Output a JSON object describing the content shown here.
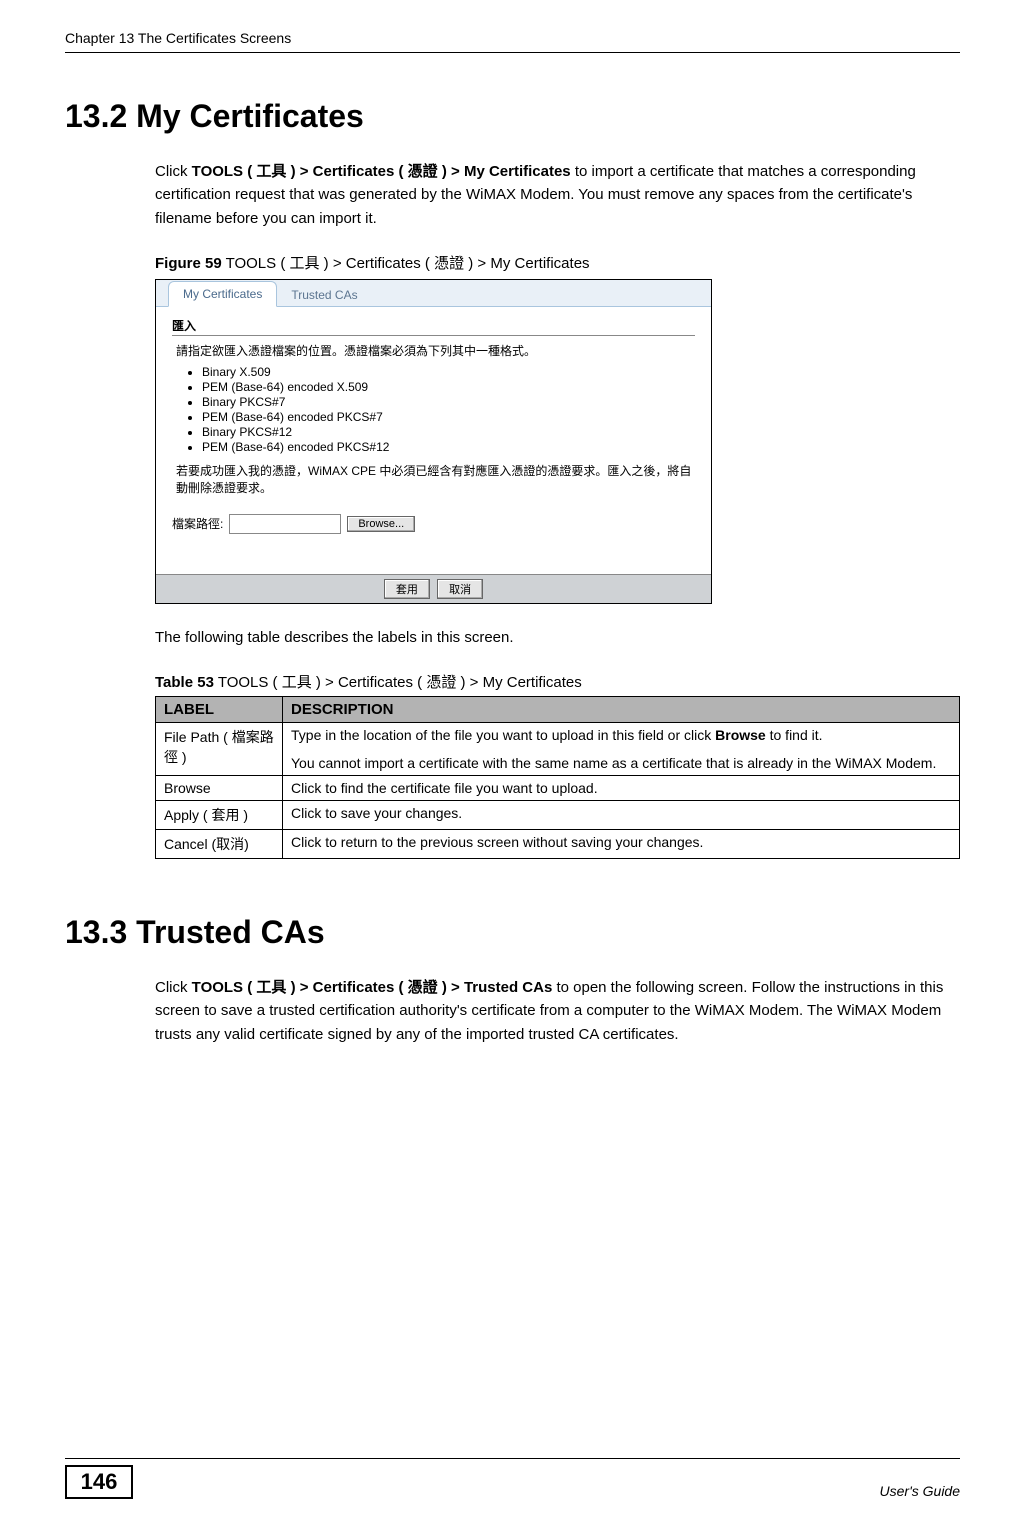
{
  "header": {
    "running": "Chapter 13 The Certificates Screens"
  },
  "s1": {
    "heading": "13.2  My Certificates",
    "para_parts": {
      "p1": "Click ",
      "b1": "TOOLS ( 工具 ) > Certificates ( 憑證 ) > My Certificates",
      "p2": "  to import a certificate that matches a corresponding certification request that was generated by the WiMAX Modem. You must remove any spaces from the certificate's filename before you can import it."
    },
    "fig_label": "Figure 59",
    "fig_caption": "   TOOLS ( 工具 ) > Certificates ( 憑證 ) > My Certificates"
  },
  "screenshot": {
    "tabs": {
      "active": "My Certificates",
      "inactive": "Trusted CAs"
    },
    "section_title": "匯入",
    "desc": "請指定欲匯入憑證檔案的位置。憑證檔案必須為下列其中一種格式。",
    "formats": [
      "Binary X.509",
      "PEM (Base-64) encoded X.509",
      "Binary PKCS#7",
      "PEM (Base-64) encoded PKCS#7",
      "Binary PKCS#12",
      "PEM (Base-64) encoded PKCS#12"
    ],
    "note": "若要成功匯入我的憑證，WiMAX CPE 中必須已經含有對應匯入憑證的憑證要求。匯入之後，將自動刪除憑證要求。",
    "path_label": "檔案路徑:",
    "browse_btn": "Browse...",
    "apply_btn": "套用",
    "cancel_btn": "取消"
  },
  "after_fig": "The following table describes the labels in this screen.",
  "table": {
    "caption_label": "Table 53",
    "caption_text": "   TOOLS ( 工具 ) > Certificates ( 憑證 ) > My Certificates",
    "head": {
      "label": "LABEL",
      "desc": "DESCRIPTION"
    },
    "rows": [
      {
        "label": "File Path ( 檔案路徑 )",
        "desc_p1_a": "Type in the location of the file you want to upload in this field or click ",
        "desc_p1_b": "Browse",
        "desc_p1_c": " to find it.",
        "desc_p2": "You cannot import a certificate with the same name as a certificate that is already in the WiMAX Modem."
      },
      {
        "label": "Browse",
        "desc": "Click to find the certificate file you want to upload."
      },
      {
        "label": "Apply ( 套用 )",
        "desc": "Click to save your changes."
      },
      {
        "label": "Cancel (取消)",
        "desc": "Click to return to the previous screen without saving your changes."
      }
    ]
  },
  "s2": {
    "heading": "13.3  Trusted CAs",
    "para_parts": {
      "p1": "Click ",
      "b1": "TOOLS ( 工具 ) > Certificates ( 憑證 ) > Trusted CAs",
      "p2": " to open the following screen. Follow the instructions in this screen to save a trusted certification authority's certificate from a computer to the WiMAX Modem. The WiMAX Modem trusts any valid certificate signed by any of the imported trusted CA certificates."
    }
  },
  "footer": {
    "page_number": "146",
    "guide": "User's Guide"
  }
}
